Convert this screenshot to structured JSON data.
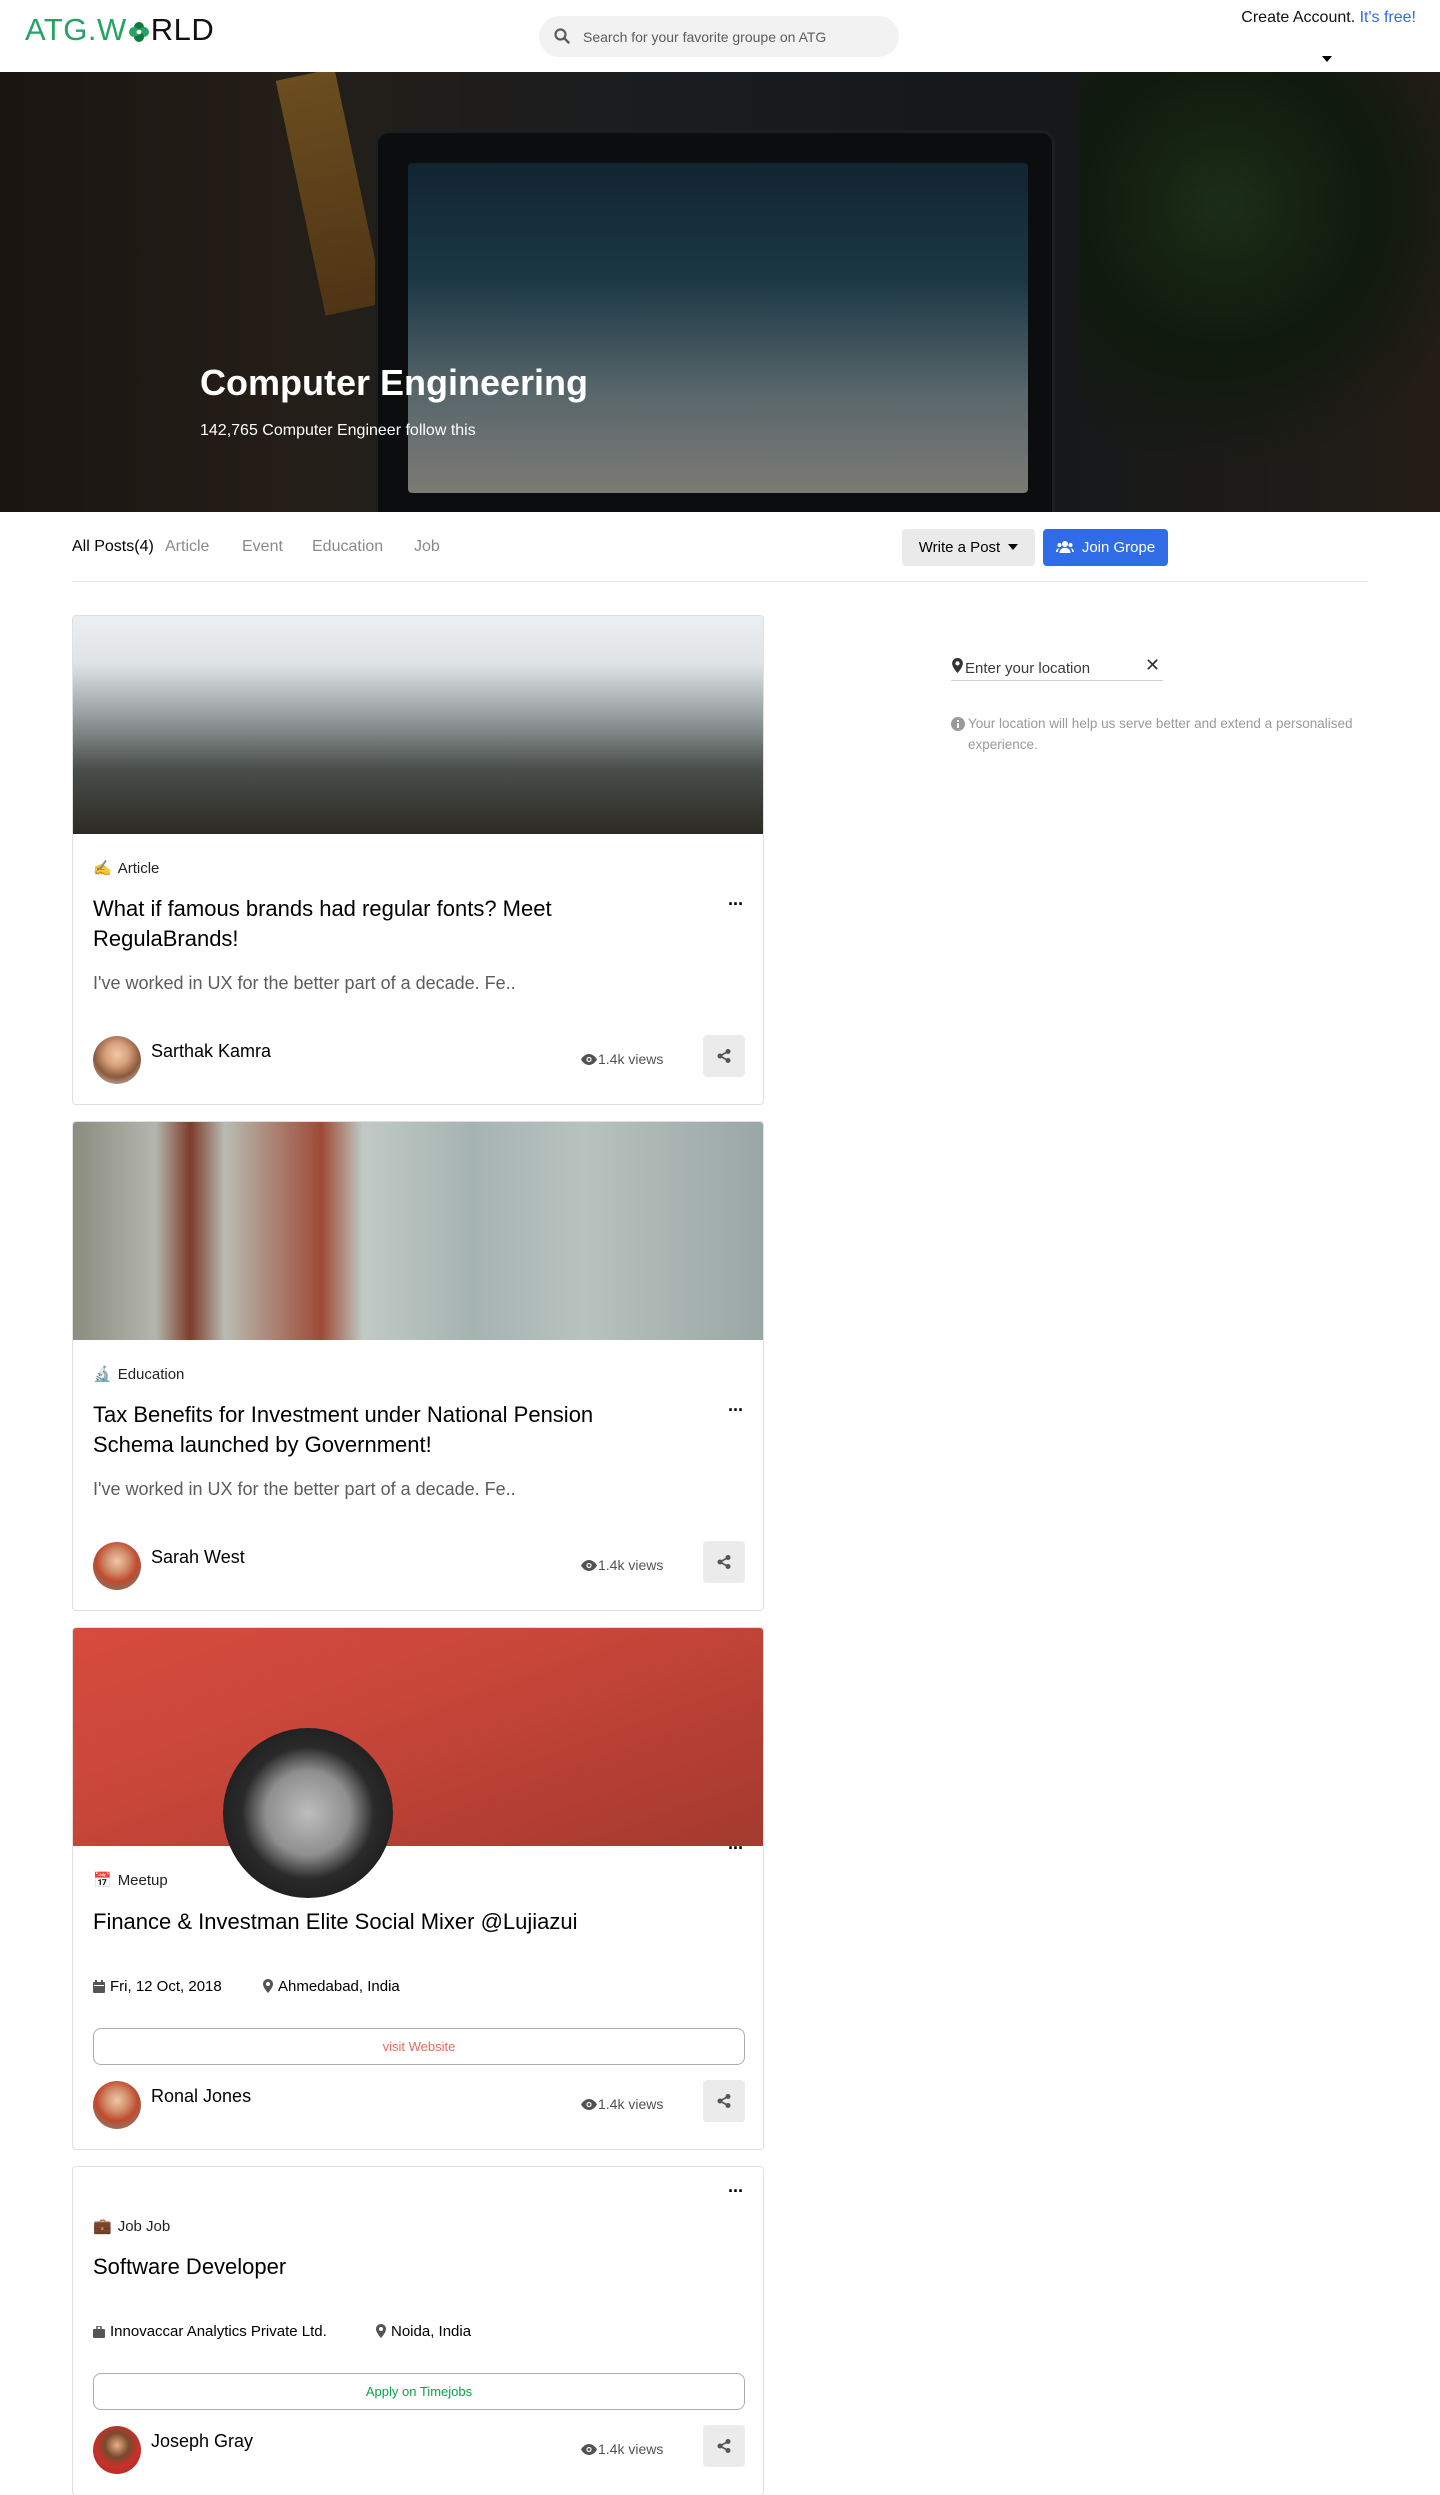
{
  "header": {
    "logo_prefix": "ATG.W",
    "logo_suffix": "RLD",
    "search_placeholder": "Search for your favorite groupe on ATG",
    "create_account": "Create Account.",
    "free": "It's free!"
  },
  "hero": {
    "title": "Computer Engineering",
    "subtitle": "142,765 Computer Engineer follow this"
  },
  "tabs": [
    {
      "label": "All Posts(4)",
      "active": true
    },
    {
      "label": "Article",
      "active": false
    },
    {
      "label": "Event",
      "active": false
    },
    {
      "label": "Education",
      "active": false
    },
    {
      "label": "Job",
      "active": false
    }
  ],
  "actions": {
    "write_post": "Write a Post",
    "join_group": "Join Grope"
  },
  "posts": [
    {
      "category_icon": "pencil-hand-icon",
      "category": "Article",
      "title": "What if famous brands had regular fonts? Meet RegulaBrands!",
      "excerpt": "I've worked in UX for the better part of a decade. Fe..",
      "author": "Sarthak Kamra",
      "views": "1.4k views"
    },
    {
      "category_icon": "microscope-icon",
      "category": "Education",
      "title": "Tax Benefits for Investment under National Pension Schema launched by Government!",
      "excerpt": "I've worked in UX for the better part of a decade. Fe..",
      "author": "Sarah West",
      "views": "1.4k views"
    },
    {
      "category_icon": "calendar-icon",
      "category": "Meetup",
      "title": "Finance & Investman Elite Social Mixer @Lujiazui",
      "date": "Fri, 12 Oct, 2018",
      "location": "Ahmedabad, India",
      "cta": "visit Website",
      "author": "Ronal Jones",
      "views": "1.4k views"
    },
    {
      "category_icon": "briefcase-icon",
      "category": "Job Job",
      "title": "Software Developer",
      "company": "Innovaccar Analytics Private Ltd.",
      "location": "Noida, India",
      "cta": "Apply on Timejobs",
      "author": "Joseph Gray",
      "views": "1.4k views"
    }
  ],
  "sidebar": {
    "location_placeholder": "Enter your location",
    "hint": "Your location will help us serve better and extend a personalised experience."
  },
  "colors": {
    "brand_green": "#27a365",
    "accent_blue": "#2f6ce5",
    "visit_orange": "#e56c5a",
    "apply_green": "#0aa34a"
  }
}
